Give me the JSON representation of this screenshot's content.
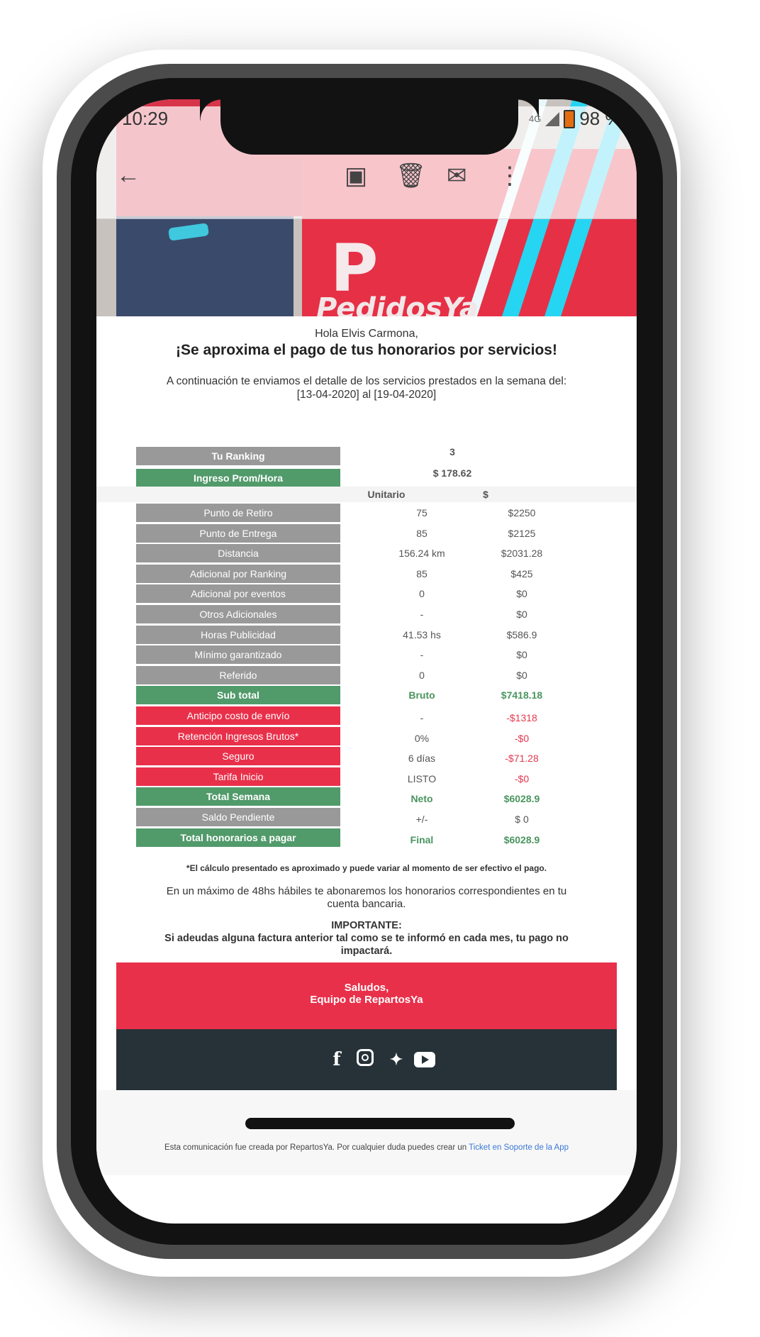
{
  "status_bar": {
    "time": "10:29",
    "network": "4G",
    "battery": "98 %"
  },
  "header_image": {
    "brand": "PedidosYa"
  },
  "email": {
    "greeting": "Hola Elvis Carmona,",
    "headline": "¡Se aproxima el pago de tus honorarios por servicios!",
    "intro_line1": "A continuación te enviamos el detalle de los servicios prestados en la semana del:",
    "intro_line2": "[13-04-2020] al [19-04-2020]"
  },
  "summary": [
    {
      "label": "Tu Ranking",
      "value": "3"
    },
    {
      "label": "Ingreso Prom/Hora",
      "value": "$ 178.62"
    }
  ],
  "table_headers": {
    "unit": "Unitario",
    "amount": "$"
  },
  "rows": [
    {
      "label": "Punto de Retiro",
      "unit": "75",
      "amount": "$2250"
    },
    {
      "label": "Punto de Entrega",
      "unit": "85",
      "amount": "$2125"
    },
    {
      "label": "Distancia",
      "unit": "156.24 km",
      "amount": "$2031.28"
    },
    {
      "label": "Adicional por Ranking",
      "unit": "85",
      "amount": "$425"
    },
    {
      "label": "Adicional por eventos",
      "unit": "0",
      "amount": "$0"
    },
    {
      "label": "Otros Adicionales",
      "unit": "-",
      "amount": "$0"
    },
    {
      "label": "Horas Publicidad",
      "unit": "41.53 hs",
      "amount": "$586.9"
    },
    {
      "label": "Mínimo garantizado",
      "unit": "-",
      "amount": "$0"
    },
    {
      "label": "Referido",
      "unit": "0",
      "amount": "$0"
    },
    {
      "label": "Sub total",
      "unit": "Bruto",
      "amount": "$7418.18"
    },
    {
      "label": "Anticipo costo de envío",
      "unit": "-",
      "amount": "-$1318"
    },
    {
      "label": "Retención Ingresos Brutos*",
      "unit": "0%",
      "amount": "-$0"
    },
    {
      "label": "Seguro",
      "unit": "6 días",
      "amount": "-$71.28"
    },
    {
      "label": "Tarifa Inicio",
      "unit": "LISTO",
      "amount": "-$0"
    },
    {
      "label": "Total Semana",
      "unit": "Neto",
      "amount": "$6028.9"
    },
    {
      "label": "Saldo Pendiente",
      "unit": "+/-",
      "amount": "$ 0"
    },
    {
      "label": "Total honorarios a pagar",
      "unit": "Final",
      "amount": "$6028.9"
    }
  ],
  "notes": {
    "disclaimer": "*El cálculo presentado es aproximado y puede variar al momento de ser efectivo el pago.",
    "payment_line1": "En un máximo de 48hs hábiles te abonaremos los honorarios correspondientes en tu",
    "payment_line2": "cuenta bancaria.",
    "important_title": "IMPORTANTE:",
    "important_line1": "Si adeudas alguna factura anterior tal como se te informó en cada mes, tu pago no",
    "important_line2": "impactará."
  },
  "footer": {
    "greeting": "Saludos,",
    "signature": "Equipo de RepartosYa",
    "communication_text": "Esta comunicación fue creada por RepartosYa. Por cualquier duda puedes crear un",
    "link_text": "Ticket en Soporte de la App"
  },
  "colors": {
    "gray": "#999999",
    "green": "#519a6a",
    "red": "#e9304a",
    "dark": "#263238"
  }
}
